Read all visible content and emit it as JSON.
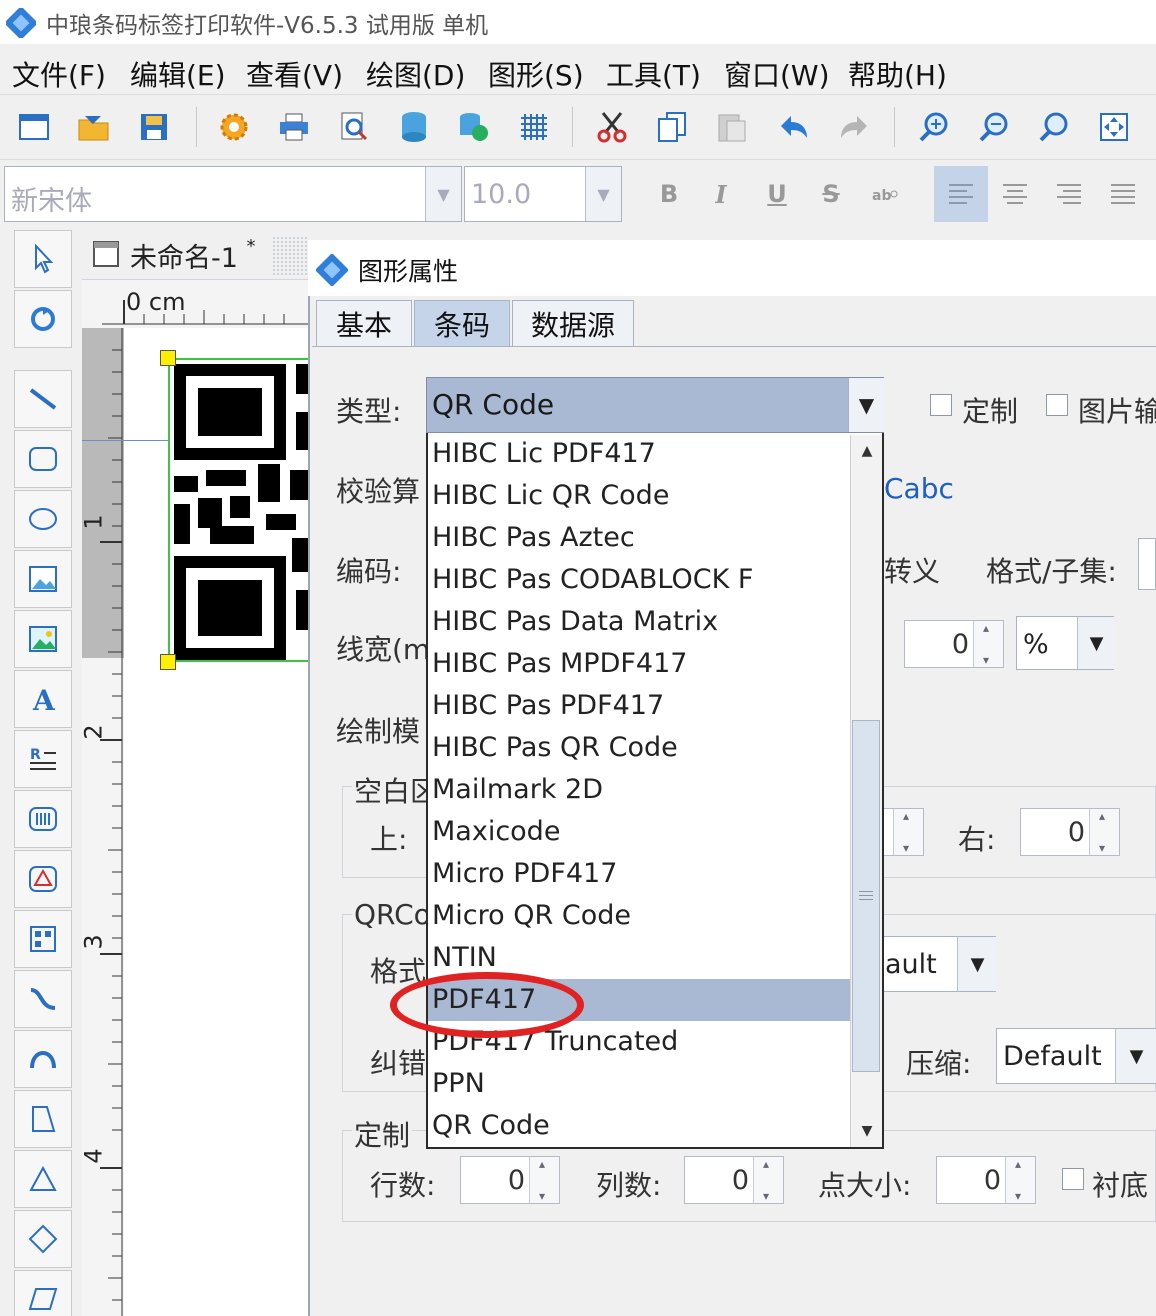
{
  "app": {
    "title": "中琅条码标签打印软件-V6.5.3 试用版 单机"
  },
  "menu": [
    "文件(F)",
    "编辑(E)",
    "查看(V)",
    "绘图(D)",
    "图形(S)",
    "工具(T)",
    "窗口(W)",
    "帮助(H)"
  ],
  "toolbar": {
    "icons": [
      "new-icon",
      "open-icon",
      "save-icon",
      "settings-icon",
      "print-icon",
      "print-preview-icon",
      "database-icon",
      "database-refresh-icon",
      "grid-icon",
      "cut-icon",
      "copy-icon",
      "paste-icon",
      "undo-icon",
      "redo-icon",
      "zoom-in-icon",
      "zoom-out-icon",
      "zoom-icon",
      "fit-page-icon"
    ]
  },
  "format": {
    "font": "新宋体",
    "size": "10.0",
    "bold": "B",
    "italic": "I",
    "underline": "U",
    "strike": "S"
  },
  "document": {
    "tab_title": "未命名-1",
    "modified_mark": "*",
    "ruler_origin": "0 cm",
    "ruler_marks": [
      "1",
      "2",
      "3",
      "4"
    ]
  },
  "dialog": {
    "title": "图形属性",
    "tabs": [
      "基本",
      "条码",
      "数据源"
    ],
    "active_tab": "条码",
    "type_label": "类型:",
    "type_value": "QR Code",
    "checkbox_custom": "定制",
    "checkbox_image": "图片输",
    "check_algo_label": "校验算",
    "check_algo_value": "Cabc",
    "encode_label": "编码:",
    "escape_label": "转义",
    "format_subset_label": "格式/子集:",
    "line_width_label": "线宽(m",
    "line_width_value": "0",
    "line_width_unit": "%",
    "draw_mode_label": "绘制模",
    "blank_group_label": "空白区",
    "top_label": "上:",
    "right_label": "右:",
    "right_value": "0",
    "qrcode_group_label": "QRCo",
    "format_label": "格式",
    "format_value": "ault",
    "error_label": "纠错",
    "compress_label": "压缩:",
    "compress_value": "Default",
    "custom_group_label": "定制",
    "rows_label": "行数:",
    "rows_value": "0",
    "cols_label": "列数:",
    "cols_value": "0",
    "dot_size_label": "点大小:",
    "dot_size_value": "0",
    "backing_label": "衬底"
  },
  "dropdown": {
    "options": [
      "HIBC Lic PDF417",
      "HIBC Lic QR Code",
      "HIBC Pas Aztec",
      "HIBC Pas CODABLOCK F",
      "HIBC Pas Data Matrix",
      "HIBC Pas MPDF417",
      "HIBC Pas PDF417",
      "HIBC Pas QR Code",
      "Mailmark 2D",
      "Maxicode",
      "Micro PDF417",
      "Micro QR Code",
      "NTIN",
      "PDF417",
      "PDF417 Truncated",
      "PPN",
      "QR Code"
    ],
    "highlighted": "PDF417"
  },
  "colors": {
    "selection": "#a9b9d3",
    "annotation": "#e02222",
    "handle": "#ffee00"
  }
}
